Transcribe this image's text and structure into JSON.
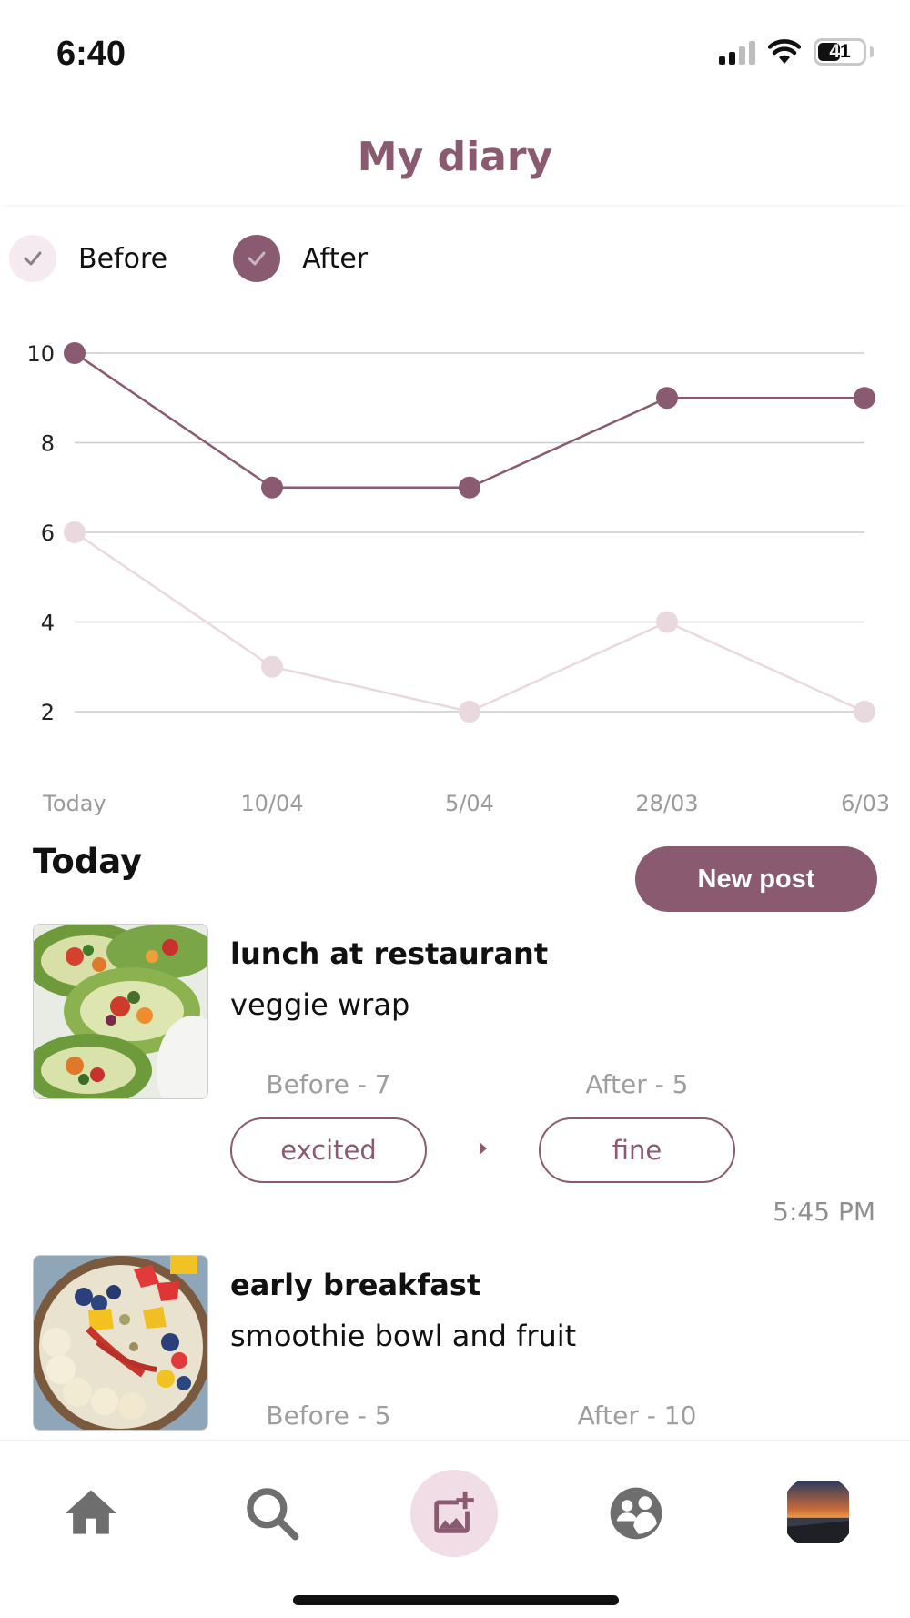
{
  "status_bar": {
    "time": "6:40",
    "battery": "41"
  },
  "header": {
    "title": "My diary"
  },
  "legend": {
    "before_label": "Before",
    "after_label": "After"
  },
  "colors": {
    "accent": "#8a5b70",
    "before_series": "#ead8df",
    "after_series": "#8a5b70",
    "grid": "#cccccc"
  },
  "chart_data": {
    "type": "line",
    "categories": [
      "Today",
      "10/04",
      "5/04",
      "28/03",
      "6/03"
    ],
    "series": [
      {
        "name": "After",
        "values": [
          10,
          7,
          7,
          9,
          9
        ]
      },
      {
        "name": "Before",
        "values": [
          6,
          3,
          2,
          4,
          2
        ]
      }
    ],
    "yticks": [
      2,
      4,
      6,
      8,
      10
    ],
    "ylim": [
      2,
      10
    ],
    "grid": true,
    "legend": "top-left"
  },
  "section": {
    "title": "Today",
    "new_post_label": "New post"
  },
  "posts": [
    {
      "title": "lunch at restaurant",
      "description": "veggie wrap",
      "before_label": "Before - 7",
      "after_label": "After - 5",
      "before_mood": "excited",
      "after_mood": "fine",
      "time": "5:45 PM",
      "image": "veggie-wrap-photo"
    },
    {
      "title": "early breakfast",
      "description": "smoothie bowl and fruit",
      "before_label": "Before - 5",
      "after_label": "After - 10",
      "image": "smoothie-bowl-photo"
    }
  ],
  "nav": {
    "items": [
      "home-icon",
      "search-icon",
      "add-photo-icon",
      "community-icon",
      "profile-avatar"
    ]
  }
}
